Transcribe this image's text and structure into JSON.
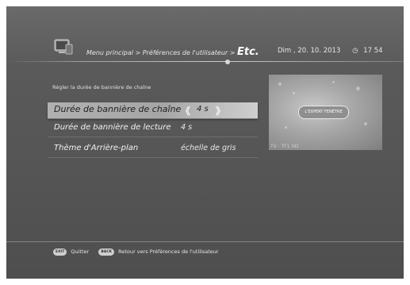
{
  "header": {
    "breadcrumb_path": "Menu principal > Préférences de l'utilisateur >",
    "breadcrumb_current": "Etc.",
    "date": "Dim , 20. 10. 2013",
    "time": "17 54"
  },
  "settings": {
    "section_title": "Régler la durée de bannière de chaîne",
    "rows": [
      {
        "label": "Durée de bannière de chaîne",
        "value": "4 s",
        "selected": true
      },
      {
        "label": "Durée de bannière de lecture",
        "value": "4 s",
        "selected": false
      },
      {
        "label": "Thème d'Arrière-plan",
        "value": "échelle de gris",
        "selected": false
      }
    ]
  },
  "preview": {
    "badge_text": "L'EXPERT FENÊTRE",
    "caption": "TV · TF1 HD"
  },
  "footer": {
    "exit_key": "EXIT",
    "exit_label": "Quitter",
    "back_key": "BACK",
    "back_label": "Retour vers Préférences de l'utilisateur"
  },
  "icons": {
    "tv": "tv-icon",
    "clock": "clock-icon",
    "left": "chevron-left-icon",
    "right": "chevron-right-icon"
  }
}
